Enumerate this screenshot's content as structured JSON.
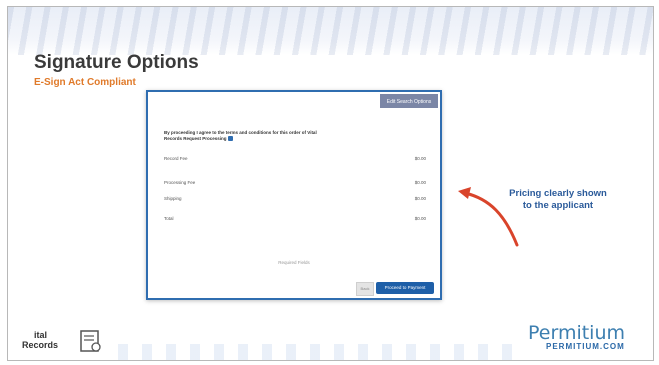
{
  "slide": {
    "title": "Signature Options",
    "subtitle": "E-Sign Act Compliant"
  },
  "dialog": {
    "header_button": "Edit Search Options",
    "intro_text": "By proceeding I agree to the terms and conditions for this order of Vital Records Request Processing",
    "rows": [
      {
        "label": "Record Fee",
        "price": "$0.00"
      },
      {
        "label": "Processing Fee",
        "price": "$0.00"
      },
      {
        "label": "Shipping",
        "price": "$0.00"
      },
      {
        "label": "Total",
        "price": "$0.00"
      }
    ],
    "center_note": "Required Fields",
    "back_label": "Back",
    "proceed_label": "Proceed to Payment"
  },
  "annotation": {
    "line1": "Pricing clearly shown",
    "line2": "to the applicant"
  },
  "footer": {
    "left_line1": "ital",
    "left_line2": "Records",
    "brand": "Permitium",
    "brand_url": "PERMITIUM.COM"
  },
  "colors": {
    "accent_orange": "#e07a2a",
    "brand_blue": "#3d7fb0",
    "arrow_red": "#d9442b",
    "dialog_border": "#2f6db0"
  }
}
